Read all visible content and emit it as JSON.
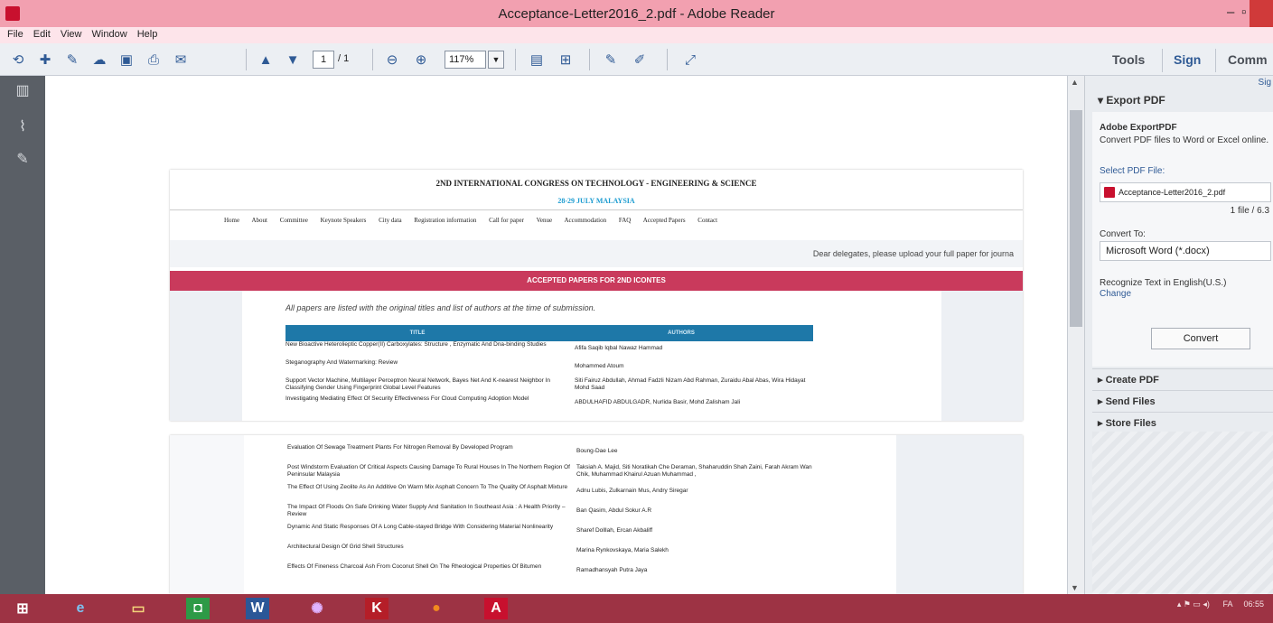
{
  "window": {
    "title": "Acceptance-Letter2016_2.pdf - Adobe Reader",
    "minimize_glyph": "–",
    "maximize_glyph": "▫"
  },
  "menu": [
    "File",
    "Edit",
    "View",
    "Window",
    "Help"
  ],
  "toolbar": {
    "page_current": "1",
    "page_total": "/ 1",
    "zoom": "117%",
    "tools_label": "Tools",
    "sign_label": "Sign",
    "comment_label": "Comm"
  },
  "document": {
    "conference_title": "2ND INTERNATIONAL CONGRESS ON TECHNOLOGY - ENGINEERING & SCIENCE",
    "conference_dates": "28-29 JULY MALAYSIA",
    "nav": [
      "Home",
      "About",
      "Committee",
      "Keynote Speakers",
      "City data",
      "Registration information",
      "Call for paper",
      "Venue",
      "Accommodation",
      "FAQ",
      "Accepted Papers",
      "Contact"
    ],
    "notice": "Dear delegates, please upload your full paper for journa",
    "accepted_header": "ACCEPTED PAPERS FOR 2ND ICONTES",
    "intro": "All papers are listed with the original titles and list of authors at the time of submission.",
    "table_headers": [
      "TITLE",
      "AUTHORS"
    ],
    "papers_page1": [
      {
        "title": "New Bioactive Heterolieptic Copper(II) Carboxylates: Structure , Enzymatic And Dna-binding Studies",
        "authors": "Afifa Saqib Iqbal Nawaz Hammad"
      },
      {
        "title": "Steganography And Watermarking: Review",
        "authors": "Mohammed Atoum"
      },
      {
        "title": "Support Vector Machine, Multilayer Perceptron Neural Network, Bayes Net And K-nearest Neighbor In Classifying Gender Using Fingerprint Global Level Features",
        "authors": "Siti Fairuz Abdullah, Ahmad Fadzli Nizam Abd Rahman, Zuraidu Abal Abas, Wira Hidayat Mohd Saad"
      },
      {
        "title": "Investigating Mediating Effect Of Security Effectiveness For Cloud Computing Adoption Model",
        "authors": "ABDULHAFID ABDULGADR, Nurlida Basir, Mohd Zalisham Jali"
      }
    ],
    "papers_page2": [
      {
        "title": "Evaluation Of Sewage Treatment Plants For Nitrogen Removal By Developed Program",
        "authors": "Boung-Dae Lee"
      },
      {
        "title": "Post Windstorm Evaluation Of Critical Aspects Causing Damage To Rural Houses In The Northern Region Of Peninsular Malaysia",
        "authors": "Taksiah A. Majid, Siti Noratikah Che Deraman, Shaharuddin Shah Zaini, Farah Akram Wan Chik, Muhammad Khairul Azuan Muhammad ,"
      },
      {
        "title": "The Effect Of Using Zeolite As An Additive On Warm Mix Asphalt Concern To The Quality Of Asphalt Mixture",
        "authors": "Adnu Lubis, Zulkarnain Mus, Andry Siregar"
      },
      {
        "title": "The Impact Of Floods On Safe Drinking Water Supply And Sanitation In Southeast Asia : A Health Priority – Review",
        "authors": "Ban Qasim, Abdul Sokur A.R"
      },
      {
        "title": "Dynamic And Static Responses Of A Long Cable-stayed Bridge With Considering Material Nonlinearity",
        "authors": "Sharef Dolllah, Ercan Akbaliff"
      },
      {
        "title": "Architectural Design Of Grid Shell Structures",
        "authors": "Marina Rynkovskaya, Maria Salekh"
      },
      {
        "title": "Effects Of Fineness Charcoal Ash From Coconut Shell On The Rheological Properties Of Bitumen",
        "authors": "Ramadhansyah Putra Jaya"
      }
    ]
  },
  "right_pane": {
    "sign_link": "Sig",
    "export_header": "Export PDF",
    "service_name": "Adobe ExportPDF",
    "service_desc": "Convert PDF files to Word or Excel online.",
    "select_file_label": "Select PDF File:",
    "selected_file": "Acceptance-Letter2016_2.pdf",
    "file_count": "1 file / 6.3",
    "convert_to_label": "Convert To:",
    "convert_to_value": "Microsoft Word (*.docx)",
    "recognize_text": "Recognize Text in English(U.S.)",
    "change_link": "Change",
    "convert_button": "Convert",
    "sections": [
      "Create PDF",
      "Send Files",
      "Store Files"
    ]
  },
  "taskbar": {
    "tray_time": "06:55",
    "tray_lang": "FA"
  }
}
